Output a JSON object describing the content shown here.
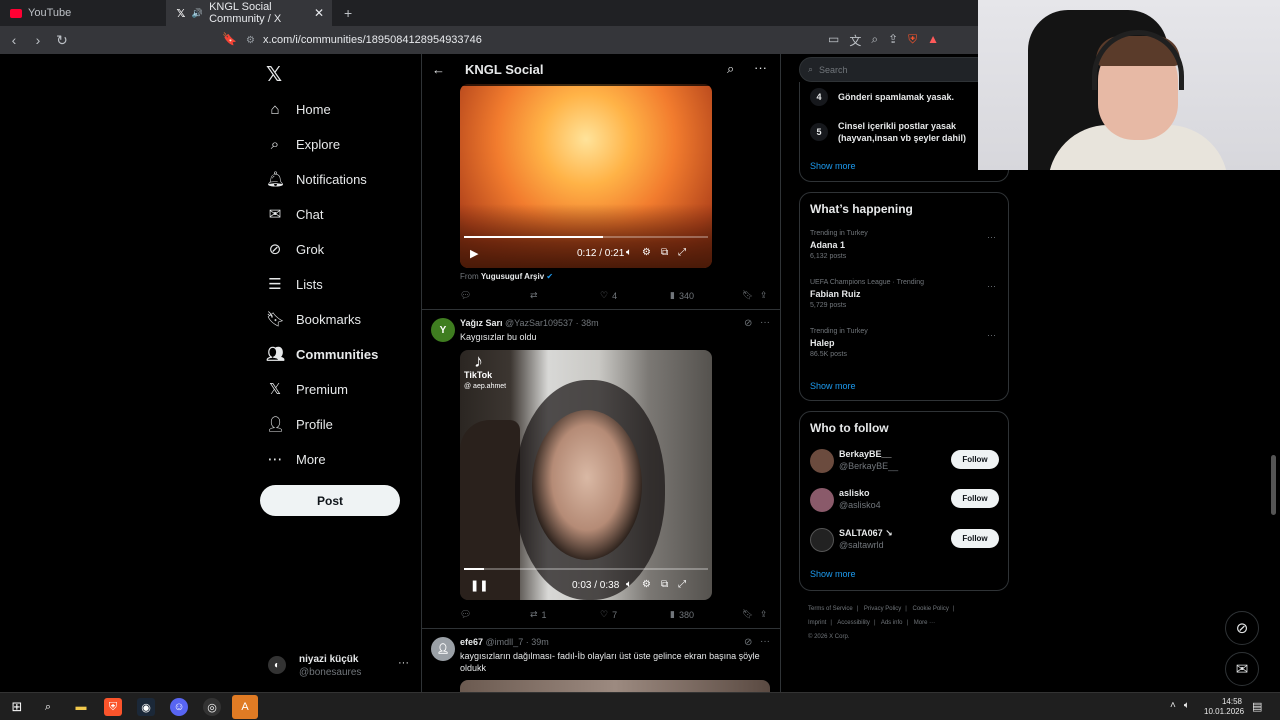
{
  "browser": {
    "tabs": [
      {
        "label": "YouTube",
        "icon": "youtube-icon"
      },
      {
        "label": "KNGL Social Community / X",
        "icon": "x-icon",
        "active": true
      }
    ],
    "url": "x.com/i/communities/1895084128954933746"
  },
  "nav": {
    "items": [
      {
        "label": "Home",
        "icon": "home-icon"
      },
      {
        "label": "Explore",
        "icon": "search-icon"
      },
      {
        "label": "Notifications",
        "icon": "bell-icon"
      },
      {
        "label": "Chat",
        "icon": "mail-icon"
      },
      {
        "label": "Grok",
        "icon": "grok-icon"
      },
      {
        "label": "Lists",
        "icon": "list-icon"
      },
      {
        "label": "Bookmarks",
        "icon": "bookmark-icon"
      },
      {
        "label": "Communities",
        "icon": "communities-icon",
        "active": true
      },
      {
        "label": "Premium",
        "icon": "x-icon"
      },
      {
        "label": "Profile",
        "icon": "person-icon"
      },
      {
        "label": "More",
        "icon": "more-circle-icon"
      }
    ],
    "post_label": "Post",
    "account": {
      "name": "niyazi küçük",
      "handle": "@bonesaures"
    }
  },
  "header": {
    "title": "KNGL Social"
  },
  "feed": {
    "post1": {
      "video_time": "0:12 / 0:21",
      "from_label": "From",
      "from_source": "Yugusuguf Arşiv",
      "likes": "4",
      "views": "340"
    },
    "post2": {
      "avatar_letter": "Y",
      "avatar_color": "#3f7d20",
      "name": "Yağız Sarı",
      "handle": "@YazSar109537",
      "time": "· 38m",
      "text": "Kaygısızlar bu oldu",
      "tiktok_label": "TikTok",
      "tiktok_handle": "@ aep.ahmet",
      "video_time": "0:03 / 0:38",
      "retweets": "1",
      "likes": "7",
      "views": "380"
    },
    "post3": {
      "name": "efe67",
      "handle": "@imdll_7",
      "time": "· 39m",
      "text": "kaygısızların dağılması- fadıl-İb olayları üst üste gelince ekran başına şöyle oldukk"
    }
  },
  "sidebar": {
    "search_placeholder": "Search",
    "rules": [
      {
        "num": "4",
        "text": "Gönderi spamlamak yasak."
      },
      {
        "num": "5",
        "text": "Cinsel içerikli postlar yasak (hayvan,insan vb şeyler dahil)"
      }
    ],
    "show_more": "Show more",
    "happening": {
      "title": "What’s happening",
      "trends": [
        {
          "meta": "Trending in Turkey",
          "name": "Adana 1",
          "count": "6,132 posts"
        },
        {
          "meta": "UEFA Champions League · Trending",
          "name": "Fabian Ruiz",
          "count": "5,729 posts"
        },
        {
          "meta": "Trending in Turkey",
          "name": "Halep",
          "count": "86.5K posts"
        }
      ]
    },
    "who_to_follow": {
      "title": "Who to follow",
      "users": [
        {
          "name": "BerkayBE__",
          "handle": "@BerkayBE__",
          "color": "#6b4b3e"
        },
        {
          "name": "aslisko",
          "handle": "@aslisko4",
          "color": "#8a5a6a"
        },
        {
          "name": "SALTA067 ↘",
          "handle": "@saltawrld",
          "color": "#222222"
        }
      ],
      "follow_label": "Follow"
    },
    "footer": [
      "Terms of Service",
      "|",
      "Privacy Policy",
      "|",
      "Cookie Policy",
      "|",
      "Imprint",
      "|",
      "Accessibility",
      "|",
      "Ads info",
      "|",
      "More ···",
      "© 2026 X Corp."
    ]
  },
  "taskbar": {
    "time": "14:58",
    "date": "10.01.2026"
  }
}
